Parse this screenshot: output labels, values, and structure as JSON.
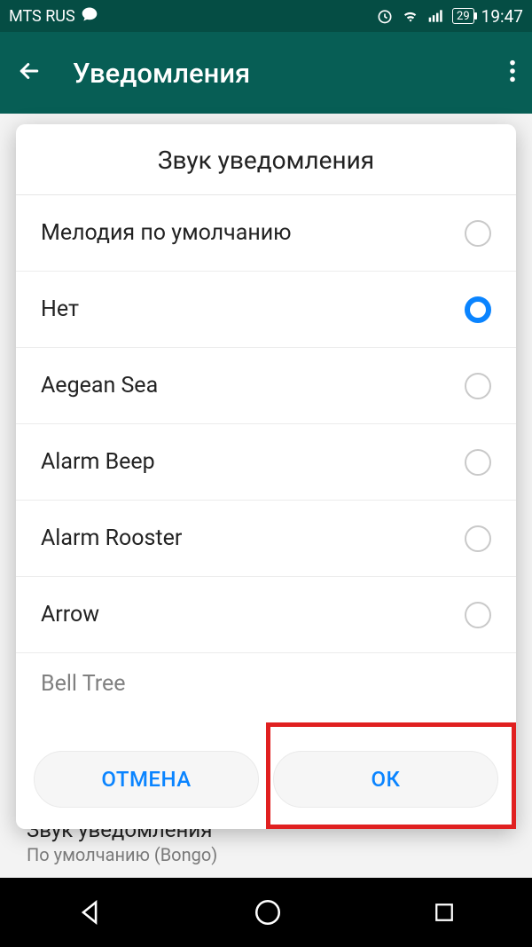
{
  "status": {
    "carrier": "MTS RUS",
    "battery_pct": "29",
    "time": "19:47"
  },
  "appbar": {
    "title": "Уведомления"
  },
  "dialog": {
    "title": "Звук уведомления",
    "options": [
      {
        "label": "Мелодия по умолчанию",
        "selected": false
      },
      {
        "label": "Нет",
        "selected": true
      },
      {
        "label": "Aegean Sea",
        "selected": false
      },
      {
        "label": "Alarm Beep",
        "selected": false
      },
      {
        "label": "Alarm Rooster",
        "selected": false
      },
      {
        "label": "Arrow",
        "selected": false
      },
      {
        "label": "Bell Tree",
        "selected": false
      }
    ],
    "cancel": "ОТМЕНА",
    "ok": "ОК"
  },
  "background_setting": {
    "title": "Звук уведомления",
    "subtitle": "По умолчанию (Bongo)"
  }
}
